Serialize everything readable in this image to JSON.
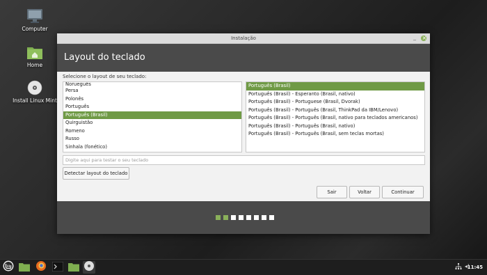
{
  "desktop": {
    "icons": [
      {
        "name": "computer-icon",
        "label": "Computer"
      },
      {
        "name": "home-folder-icon",
        "label": "Home"
      },
      {
        "name": "dvd-icon",
        "label": "Install Linux Mint"
      }
    ]
  },
  "window": {
    "title": "Instalação",
    "header": "Layout do teclado",
    "prompt": "Selecione o layout de seu teclado:",
    "layouts": [
      "Norueguês",
      "Persa",
      "Polonês",
      "Português",
      "Português (Brasil)",
      "Quirguistão",
      "Romeno",
      "Russo",
      "Sinhala (fonético)"
    ],
    "variants": [
      "Português (Brasil)",
      "Português (Brasil) - Esperanto (Brasil, nativo)",
      "Português (Brasil) - Portuguese (Brasil, Dvorak)",
      "Português (Brasil) - Português (Brasil, ThinkPad da IBM/Lenovo)",
      "Português (Brasil) - Português (Brasil, nativo para teclados americanos)",
      "Português (Brasil) - Português (Brasil, nativo)",
      "Português (Brasil) - Português (Brasil, sem teclas mortas)"
    ],
    "test_placeholder": "Digite aqui para testar o seu teclado",
    "detect_label": "Detectar layout do teclado",
    "quit_label": "Sair",
    "back_label": "Voltar",
    "next_label": "Continuar",
    "progress_steps_done": 2,
    "progress_steps_total": 8
  },
  "taskbar": {
    "clock": "11:45"
  },
  "colors": {
    "accent": "#8ab05a",
    "selection": "#6f9a45",
    "header": "#4a4a4a"
  }
}
